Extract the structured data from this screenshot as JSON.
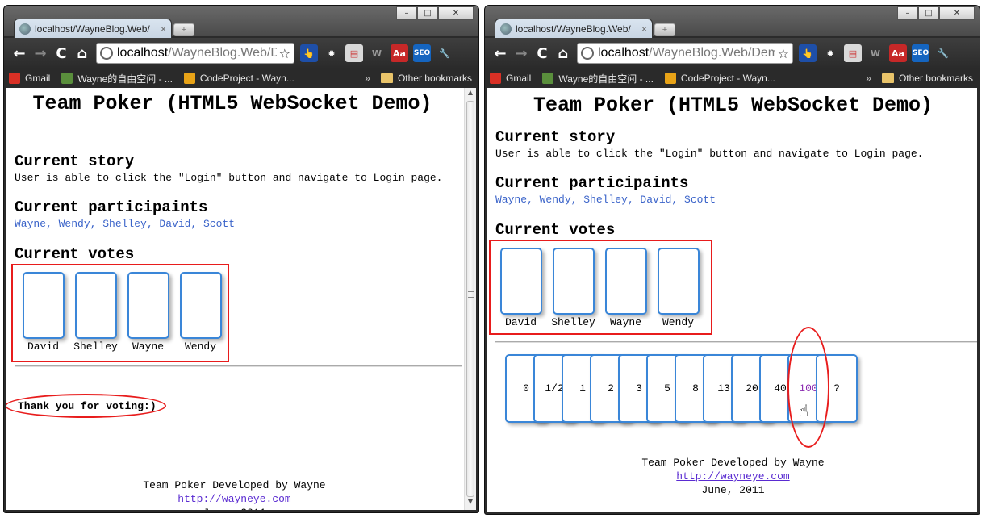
{
  "browser": {
    "tab_title": "localhost/WayneBlog.Web/",
    "tab_close": "×",
    "new_tab": "+",
    "win_minimize": "–",
    "win_maximize": "□",
    "win_close": "✕",
    "back": "←",
    "forward": "→",
    "reload": "C",
    "home": "⌂",
    "star": "☆",
    "url_host": "localhost",
    "url_path_left": "/WayneBlog.Web/D",
    "url_path_right": "/WayneBlog.Web/Demo",
    "extensions": [
      "👆",
      "✹",
      "▤",
      "W",
      "Aa",
      "SEO",
      "🔧"
    ],
    "bookmarks": [
      {
        "label": "Gmail",
        "color": "#d93025"
      },
      {
        "label": "Wayne的自由空间 - ...",
        "color": "#5a8f3c"
      },
      {
        "label": "CodeProject - Wayn...",
        "color": "#e8a317"
      }
    ],
    "bookmarks_more": "»",
    "other_bookmarks": "Other bookmarks"
  },
  "page": {
    "title": "Team Poker (HTML5 WebSocket Demo)",
    "story_heading": "Current story",
    "story_text": "User is able to click the \"Login\" button and navigate to Login page.",
    "participants_heading": "Current participaints",
    "participants": "Wayne, Wendy, Shelley, David, Scott",
    "votes_heading": "Current votes",
    "votes": [
      "David",
      "Shelley",
      "Wayne",
      "Wendy"
    ],
    "thanks": "Thank you for voting:)",
    "poker_cards": [
      "0",
      "1/2",
      "1",
      "2",
      "3",
      "5",
      "8",
      "13",
      "20",
      "40",
      "100",
      "?"
    ],
    "selected_card": "100",
    "footer_line1": "Team Poker Developed by Wayne",
    "footer_link": "http://wayneye.com",
    "footer_date": "June, 2011"
  },
  "colors": {
    "highlight_red": "#e81c1c",
    "card_border": "#3a86d8",
    "participants_blue": "#3a63c9",
    "selected_card_purple": "#8b2bb0"
  }
}
